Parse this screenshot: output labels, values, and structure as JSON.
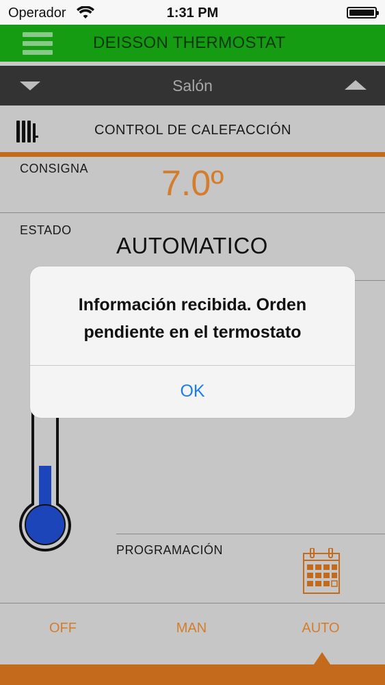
{
  "status_bar": {
    "carrier": "Operador",
    "time": "1:31 PM",
    "wifi_icon": "wifi-icon",
    "battery_icon": "battery-icon"
  },
  "header": {
    "title": "DEISSON THERMOSTAT",
    "menu_icon": "hamburger-icon",
    "color": "#159c12"
  },
  "room": {
    "name": "Salón",
    "prev_icon": "triangle-down-icon",
    "next_icon": "triangle-up-icon"
  },
  "control": {
    "title": "CONTROL DE CALEFACCIÓN",
    "icon": "radiator-icon"
  },
  "consigna": {
    "label": "CONSIGNA",
    "value": "7.0º"
  },
  "estado": {
    "label": "ESTADO",
    "value": "AUTOMATICO"
  },
  "programacion": {
    "label": "PROGRAMACIÓN",
    "icon": "calendar-icon"
  },
  "thermometer": {
    "icon": "thermometer-icon"
  },
  "tabs": {
    "items": [
      {
        "label": "OFF"
      },
      {
        "label": "MAN"
      },
      {
        "label": "AUTO"
      }
    ],
    "selected": "AUTO"
  },
  "alert": {
    "message": "Información recibida. Orden pendiente en el termostato",
    "ok_label": "OK"
  },
  "colors": {
    "accent": "#c46a1c",
    "value_orange": "#d37d2d",
    "link_blue": "#1b7cf0",
    "thermo_blue": "#1b45b8"
  }
}
